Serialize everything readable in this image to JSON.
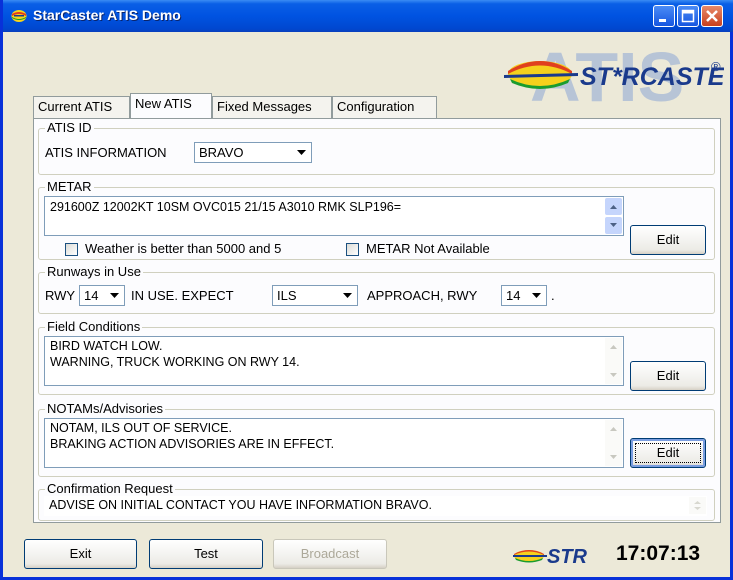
{
  "window": {
    "title": "StarCaster ATIS Demo"
  },
  "logo": {
    "big_text": "ATIS",
    "brand": "ST*RCASTER",
    "brand_star": "*",
    "registered": "®"
  },
  "tabs": [
    {
      "label": "Current ATIS"
    },
    {
      "label": "New ATIS"
    },
    {
      "label": "Fixed Messages"
    },
    {
      "label": "Configuration"
    }
  ],
  "atis_id": {
    "group_label": "ATIS ID",
    "info_label": "ATIS INFORMATION",
    "selected": "BRAVO"
  },
  "metar": {
    "group_label": "METAR",
    "text": "291600Z 12002KT 10SM OVC015 21/15 A3010 RMK SLP196=",
    "checkbox_weather": "Weather is better than 5000 and 5",
    "checkbox_na": "METAR Not Available",
    "edit_label": "Edit"
  },
  "runways": {
    "group_label": "Runways in Use",
    "rwy_label": "RWY",
    "rwy_value": "14",
    "in_use_label": "IN USE. EXPECT",
    "approach_value": "ILS",
    "approach_label": "APPROACH, RWY",
    "approach_rwy_value": "14",
    "period": "."
  },
  "field_conditions": {
    "group_label": "Field Conditions",
    "lines": [
      "BIRD WATCH LOW.",
      "WARNING, TRUCK WORKING ON RWY 14."
    ],
    "edit_label": "Edit"
  },
  "notams": {
    "group_label": "NOTAMs/Advisories",
    "lines": [
      "NOTAM, ILS OUT OF SERVICE.",
      "BRAKING ACTION ADVISORIES ARE IN EFFECT."
    ],
    "edit_label": "Edit"
  },
  "confirmation": {
    "group_label": "Confirmation Request",
    "text": "ADVISE ON INITIAL CONTACT YOU HAVE INFORMATION BRAVO."
  },
  "footer": {
    "exit_label": "Exit",
    "test_label": "Test",
    "broadcast_label": "Broadcast",
    "str_logo": "STR",
    "clock": "17:07:13"
  },
  "colors": {
    "titlebar": "#0053e1",
    "brand_blue": "#1a3a8c",
    "str_green": "#1a9a3a"
  }
}
